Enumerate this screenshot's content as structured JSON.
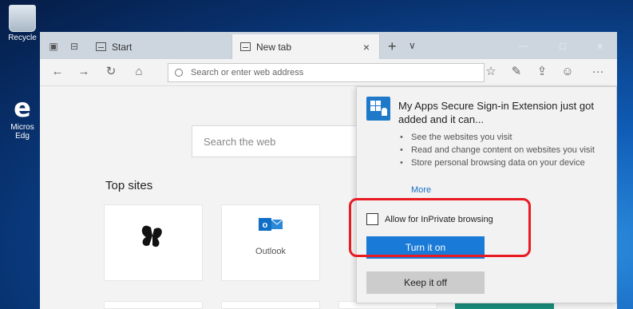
{
  "desktop": {
    "icons": [
      {
        "label": "Recycle",
        "icon": "recycle-bin-icon"
      },
      {
        "label": "Micros",
        "label2": "Edg",
        "icon": "edge-icon"
      }
    ]
  },
  "browser": {
    "tabs": [
      {
        "label": "Start",
        "icon": "tab-page-icon"
      },
      {
        "label": "New tab",
        "icon": "tab-page-icon",
        "active": true
      }
    ],
    "tab_close_glyph": "×",
    "add_tab_glyph": "+",
    "tab_list_glyph": "∨",
    "nav": {
      "back_glyph": "←",
      "forward_glyph": "→",
      "refresh_glyph": "↻",
      "home_glyph": "⌂",
      "address_placeholder": "Search or enter web address",
      "favorites_glyph": "☆",
      "notes_glyph": "✎",
      "share_glyph": "⇪",
      "feedback_glyph": "☺",
      "more_glyph": "···"
    },
    "page": {
      "search_placeholder": "Search the web",
      "top_sites_heading": "Top sites",
      "tiles": [
        {
          "label": "",
          "icon": "butterfly-icon"
        },
        {
          "label": "Outlook",
          "icon": "outlook-icon"
        }
      ]
    }
  },
  "popup": {
    "title": "My Apps Secure Sign-in Extension just got added and it can...",
    "permissions": [
      "See the websites you visit",
      "Read and change content on websites you visit",
      "Store personal browsing data on your device"
    ],
    "more_link": "More",
    "inprivate_label": "Allow for InPrivate browsing",
    "inprivate_checked": false,
    "turn_on_label": "Turn it on",
    "keep_off_label": "Keep it off"
  },
  "colors": {
    "accent": "#1a7ad7",
    "highlight": "#e81b23"
  }
}
